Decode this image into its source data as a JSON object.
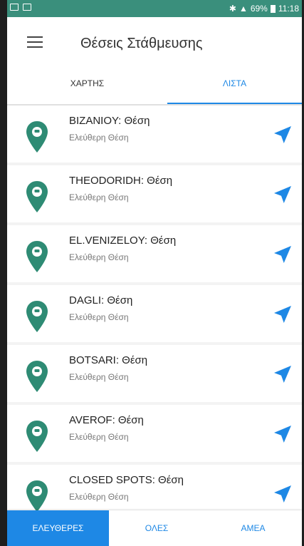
{
  "statusbar": {
    "battery": "69%",
    "time": "11:18"
  },
  "header": {
    "title": "Θέσεις Στάθμευσης"
  },
  "tabs": [
    {
      "label": "ΧΑΡΤΗΣ"
    },
    {
      "label": "ΛΙΣΤΑ"
    }
  ],
  "list": [
    {
      "name": "BIZANIOY: Θέση",
      "status": "Ελεύθερη Θέση"
    },
    {
      "name": "THEODORIDH: Θέση",
      "status": "Ελεύθερη Θέση"
    },
    {
      "name": "EL.VENIZELOY: Θέση",
      "status": "Ελεύθερη Θέση"
    },
    {
      "name": "DAGLI: Θέση",
      "status": "Ελεύθερη Θέση"
    },
    {
      "name": "BOTSARI: Θέση",
      "status": "Ελεύθερη Θέση"
    },
    {
      "name": "AVEROF: Θέση",
      "status": "Ελεύθερη Θέση"
    },
    {
      "name": "CLOSED SPOTS: Θέση",
      "status": "Ελεύθερη Θέση"
    }
  ],
  "bottom_nav": [
    {
      "label": "ΕΛΕΥΘΕΡΕΣ"
    },
    {
      "label": "ΟΛΕΣ"
    },
    {
      "label": "ΑΜΕΑ"
    }
  ],
  "colors": {
    "accent": "#1e88e5",
    "pin": "#2e8b74",
    "statusbar": "#3a8f7c"
  },
  "icons": {
    "menu": "hamburger-icon",
    "pin": "map-pin-icon",
    "navigate": "navigation-arrow-icon"
  }
}
